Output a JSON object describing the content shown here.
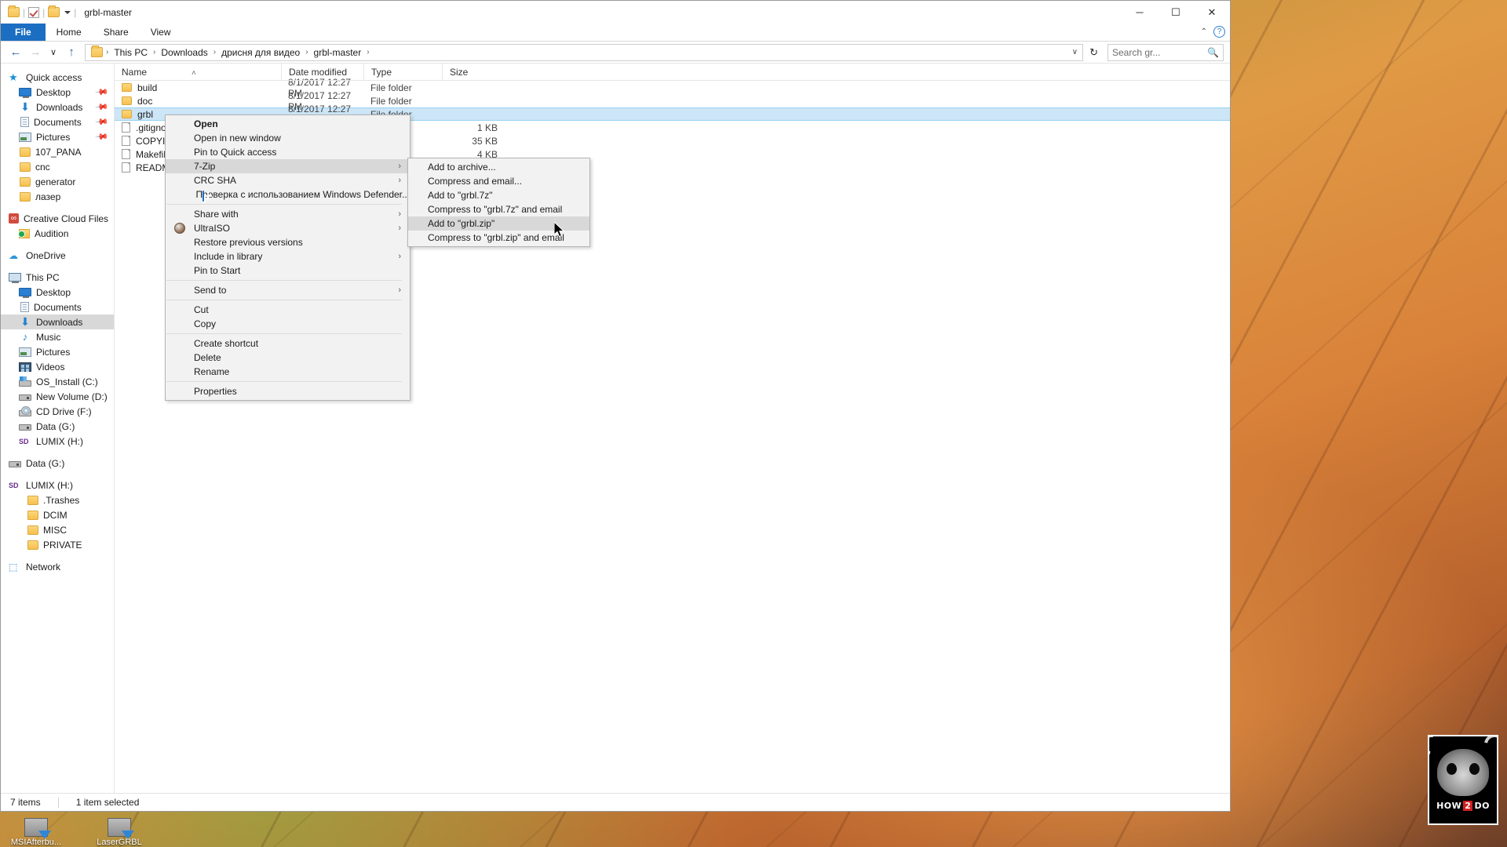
{
  "window": {
    "title": "grbl-master",
    "quick_access_icons": [
      "folder-icon",
      "properties-icon",
      "new-folder-icon",
      "customize-chevron-icon"
    ],
    "minimize_label": "─",
    "maximize_label": "☐",
    "close_label": "✕"
  },
  "ribbon": {
    "tabs": [
      {
        "label": "File",
        "active": true
      },
      {
        "label": "Home",
        "active": false
      },
      {
        "label": "Share",
        "active": false
      },
      {
        "label": "View",
        "active": false
      }
    ],
    "help_label": "?",
    "collapse_label": "⌃"
  },
  "address": {
    "back_label": "←",
    "forward_label": "→",
    "recent_label": "∨",
    "up_label": "↑",
    "breadcrumbs": [
      "This PC",
      "Downloads",
      "дрисня для видео",
      "grbl-master"
    ],
    "separator": "›",
    "dropdown_label": "∨",
    "refresh_label": "↻",
    "search_placeholder": "Search gr...",
    "search_value": ""
  },
  "sidebar": {
    "items": [
      {
        "label": "Quick access",
        "icon": "star-icon",
        "level": 0,
        "pinned": false,
        "selected": false,
        "gap": false
      },
      {
        "label": "Desktop",
        "icon": "monitor-icon",
        "level": 1,
        "pinned": true,
        "selected": false,
        "gap": false
      },
      {
        "label": "Downloads",
        "icon": "download-icon",
        "level": 1,
        "pinned": true,
        "selected": false,
        "gap": false
      },
      {
        "label": "Documents",
        "icon": "documents-icon",
        "level": 1,
        "pinned": true,
        "selected": false,
        "gap": false
      },
      {
        "label": "Pictures",
        "icon": "pictures-icon",
        "level": 1,
        "pinned": true,
        "selected": false,
        "gap": false
      },
      {
        "label": "107_PANA",
        "icon": "folder-icon",
        "level": 1,
        "pinned": false,
        "selected": false,
        "gap": false
      },
      {
        "label": "cnc",
        "icon": "folder-icon",
        "level": 1,
        "pinned": false,
        "selected": false,
        "gap": false
      },
      {
        "label": "generator",
        "icon": "folder-icon",
        "level": 1,
        "pinned": false,
        "selected": false,
        "gap": false
      },
      {
        "label": "лазер",
        "icon": "folder-icon",
        "level": 1,
        "pinned": false,
        "selected": false,
        "gap": false
      },
      {
        "label": "Creative Cloud Files",
        "icon": "creative-cloud-icon",
        "level": 0,
        "pinned": false,
        "selected": false,
        "gap": true
      },
      {
        "label": "Audition",
        "icon": "audition-sync-folder-icon",
        "level": 1,
        "pinned": false,
        "selected": false,
        "gap": false
      },
      {
        "label": "OneDrive",
        "icon": "onedrive-icon",
        "level": 0,
        "pinned": false,
        "selected": false,
        "gap": true
      },
      {
        "label": "This PC",
        "icon": "this-pc-icon",
        "level": 0,
        "pinned": false,
        "selected": false,
        "gap": true
      },
      {
        "label": "Desktop",
        "icon": "monitor-icon",
        "level": 1,
        "pinned": false,
        "selected": false,
        "gap": false
      },
      {
        "label": "Documents",
        "icon": "documents-icon",
        "level": 1,
        "pinned": false,
        "selected": false,
        "gap": false
      },
      {
        "label": "Downloads",
        "icon": "download-icon",
        "level": 1,
        "pinned": false,
        "selected": true,
        "gap": false
      },
      {
        "label": "Music",
        "icon": "music-icon",
        "level": 1,
        "pinned": false,
        "selected": false,
        "gap": false
      },
      {
        "label": "Pictures",
        "icon": "pictures-icon",
        "level": 1,
        "pinned": false,
        "selected": false,
        "gap": false
      },
      {
        "label": "Videos",
        "icon": "videos-icon",
        "level": 1,
        "pinned": false,
        "selected": false,
        "gap": false
      },
      {
        "label": "OS_Install (C:)",
        "icon": "system-drive-icon",
        "level": 1,
        "pinned": false,
        "selected": false,
        "gap": false
      },
      {
        "label": "New Volume (D:)",
        "icon": "drive-icon",
        "level": 1,
        "pinned": false,
        "selected": false,
        "gap": false
      },
      {
        "label": "CD Drive (F:)",
        "icon": "cd-drive-icon",
        "level": 1,
        "pinned": false,
        "selected": false,
        "gap": false
      },
      {
        "label": "Data (G:)",
        "icon": "drive-icon",
        "level": 1,
        "pinned": false,
        "selected": false,
        "gap": false
      },
      {
        "label": "LUMIX (H:)",
        "icon": "sd-card-icon",
        "level": 1,
        "pinned": false,
        "selected": false,
        "gap": false
      },
      {
        "label": "Data (G:)",
        "icon": "drive-icon",
        "level": 0,
        "pinned": false,
        "selected": false,
        "gap": true
      },
      {
        "label": "LUMIX (H:)",
        "icon": "sd-card-icon",
        "level": 0,
        "pinned": false,
        "selected": false,
        "gap": true
      },
      {
        "label": ".Trashes",
        "icon": "folder-icon",
        "level": 2,
        "pinned": false,
        "selected": false,
        "gap": false
      },
      {
        "label": "DCIM",
        "icon": "folder-icon",
        "level": 2,
        "pinned": false,
        "selected": false,
        "gap": false
      },
      {
        "label": "MISC",
        "icon": "folder-icon",
        "level": 2,
        "pinned": false,
        "selected": false,
        "gap": false
      },
      {
        "label": "PRIVATE",
        "icon": "folder-icon",
        "level": 2,
        "pinned": false,
        "selected": false,
        "gap": false
      },
      {
        "label": "Network",
        "icon": "network-icon",
        "level": 0,
        "pinned": false,
        "selected": false,
        "gap": true
      }
    ]
  },
  "filelist": {
    "columns": [
      {
        "label": "Name",
        "key": "name",
        "sorted": true,
        "sort_glyph": "˄"
      },
      {
        "label": "Date modified",
        "key": "date"
      },
      {
        "label": "Type",
        "key": "type"
      },
      {
        "label": "Size",
        "key": "size"
      }
    ],
    "rows": [
      {
        "name": "build",
        "date": "8/1/2017 12:27 PM",
        "type": "File folder",
        "size": "",
        "icon": "folder-icon",
        "selected": false
      },
      {
        "name": "doc",
        "date": "8/1/2017 12:27 PM",
        "type": "File folder",
        "size": "",
        "icon": "folder-icon",
        "selected": false
      },
      {
        "name": "grbl",
        "date": "8/1/2017 12:27 PM",
        "type": "File folder",
        "size": "",
        "icon": "folder-icon",
        "selected": true
      },
      {
        "name": ".gitignore",
        "date": "",
        "type": "",
        "size": "1 KB",
        "icon": "file-icon",
        "selected": false
      },
      {
        "name": "COPYING",
        "date": "",
        "type": "",
        "size": "35 KB",
        "icon": "file-icon",
        "selected": false
      },
      {
        "name": "Makefile",
        "date": "",
        "type": "",
        "size": "4 KB",
        "icon": "file-icon",
        "selected": false
      },
      {
        "name": "README.",
        "date": "",
        "type": "",
        "size": "",
        "icon": "file-icon",
        "selected": false
      }
    ]
  },
  "context_menu": {
    "items": [
      {
        "label": "Open",
        "bold": true,
        "arrow": false,
        "icon": null,
        "highlighted": false,
        "sep_after": false
      },
      {
        "label": "Open in new window",
        "bold": false,
        "arrow": false,
        "icon": null,
        "highlighted": false,
        "sep_after": false
      },
      {
        "label": "Pin to Quick access",
        "bold": false,
        "arrow": false,
        "icon": null,
        "highlighted": false,
        "sep_after": false
      },
      {
        "label": "7-Zip",
        "bold": false,
        "arrow": true,
        "icon": null,
        "highlighted": true,
        "sep_after": false
      },
      {
        "label": "CRC SHA",
        "bold": false,
        "arrow": true,
        "icon": null,
        "highlighted": false,
        "sep_after": false
      },
      {
        "label": "Проверка с использованием Windows Defender...",
        "bold": false,
        "arrow": false,
        "icon": "windows-defender-icon",
        "highlighted": false,
        "sep_after": true
      },
      {
        "label": "Share with",
        "bold": false,
        "arrow": true,
        "icon": null,
        "highlighted": false,
        "sep_after": false
      },
      {
        "label": "UltraISO",
        "bold": false,
        "arrow": true,
        "icon": "ultraiso-icon",
        "highlighted": false,
        "sep_after": false
      },
      {
        "label": "Restore previous versions",
        "bold": false,
        "arrow": false,
        "icon": null,
        "highlighted": false,
        "sep_after": false
      },
      {
        "label": "Include in library",
        "bold": false,
        "arrow": true,
        "icon": null,
        "highlighted": false,
        "sep_after": false
      },
      {
        "label": "Pin to Start",
        "bold": false,
        "arrow": false,
        "icon": null,
        "highlighted": false,
        "sep_after": true
      },
      {
        "label": "Send to",
        "bold": false,
        "arrow": true,
        "icon": null,
        "highlighted": false,
        "sep_after": true
      },
      {
        "label": "Cut",
        "bold": false,
        "arrow": false,
        "icon": null,
        "highlighted": false,
        "sep_after": false
      },
      {
        "label": "Copy",
        "bold": false,
        "arrow": false,
        "icon": null,
        "highlighted": false,
        "sep_after": true
      },
      {
        "label": "Create shortcut",
        "bold": false,
        "arrow": false,
        "icon": null,
        "highlighted": false,
        "sep_after": false
      },
      {
        "label": "Delete",
        "bold": false,
        "arrow": false,
        "icon": null,
        "highlighted": false,
        "sep_after": false
      },
      {
        "label": "Rename",
        "bold": false,
        "arrow": false,
        "icon": null,
        "highlighted": false,
        "sep_after": true
      },
      {
        "label": "Properties",
        "bold": false,
        "arrow": false,
        "icon": null,
        "highlighted": false,
        "sep_after": false
      }
    ]
  },
  "submenu": {
    "items": [
      {
        "label": "Add to archive...",
        "highlighted": false
      },
      {
        "label": "Compress and email...",
        "highlighted": false
      },
      {
        "label": "Add to \"grbl.7z\"",
        "highlighted": false
      },
      {
        "label": "Compress to \"grbl.7z\" and email",
        "highlighted": false
      },
      {
        "label": "Add to \"grbl.zip\"",
        "highlighted": true
      },
      {
        "label": "Compress to \"grbl.zip\" and email",
        "highlighted": false
      }
    ]
  },
  "status": {
    "item_count": "7 items",
    "selection": "1 item selected"
  },
  "badge": {
    "line": "HOW",
    "line2": "DO",
    "red": "2"
  },
  "desktop_icons": [
    {
      "label": "MSIAfterbu..."
    },
    {
      "label": "LaserGRBL"
    }
  ],
  "colors": {
    "accent": "#1b6ec2",
    "selection": "#cce5f7",
    "menu_bg": "#f2f2f2",
    "menu_highlight": "#d8d8d8"
  }
}
